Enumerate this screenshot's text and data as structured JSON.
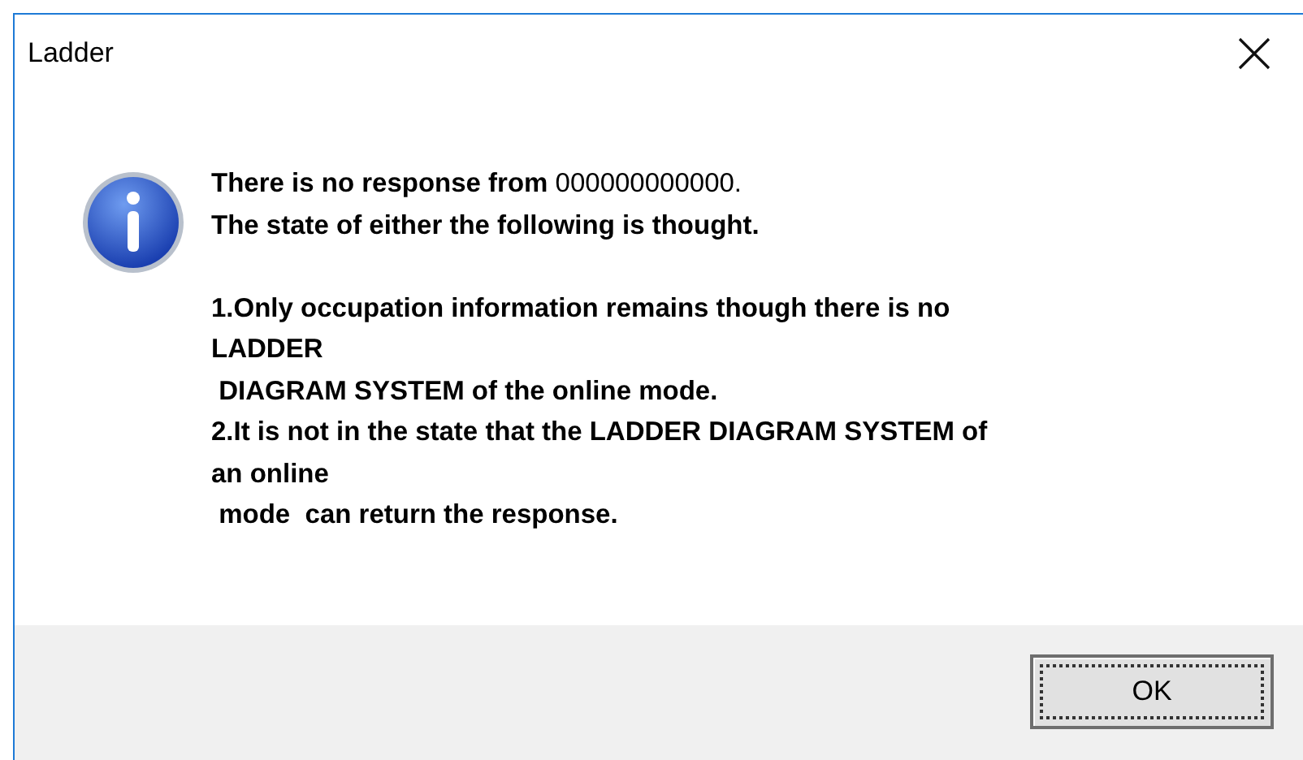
{
  "window": {
    "title": "Ladder"
  },
  "message": "**There is no response from** 000000000000.\n**The state of either the following is thought.**\n\n**1.Only occupation information remains though there is no**\n**LADDER**\n **DIAGRAM SYSTEM of the online mode.**\n**2.It is not in the state that the LADDER DIAGRAM SYSTEM of**\n**an online**\n **mode  can return the response.**",
  "buttons": [
    {
      "label": "OK",
      "focused": true
    }
  ]
}
